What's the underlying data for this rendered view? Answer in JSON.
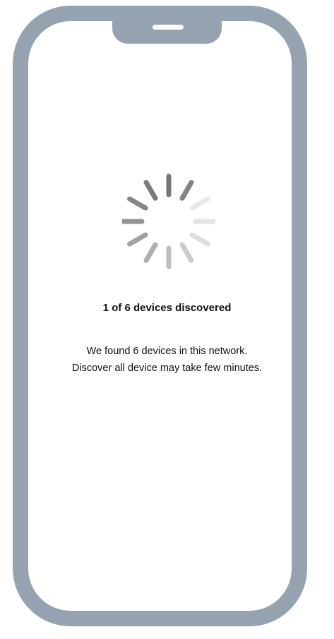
{
  "status": {
    "title": "1 of 6 devices discovered",
    "line1": "We found 6 devices in this network.",
    "line2": "Discover all device may take few minutes."
  },
  "spinner": {
    "icon": "loading-spinner-icon",
    "stroke_color": "#6f6f6f",
    "spokes": 12
  },
  "colors": {
    "frame": "#95a3b1",
    "background": "#ffffff",
    "text": "#111111"
  }
}
